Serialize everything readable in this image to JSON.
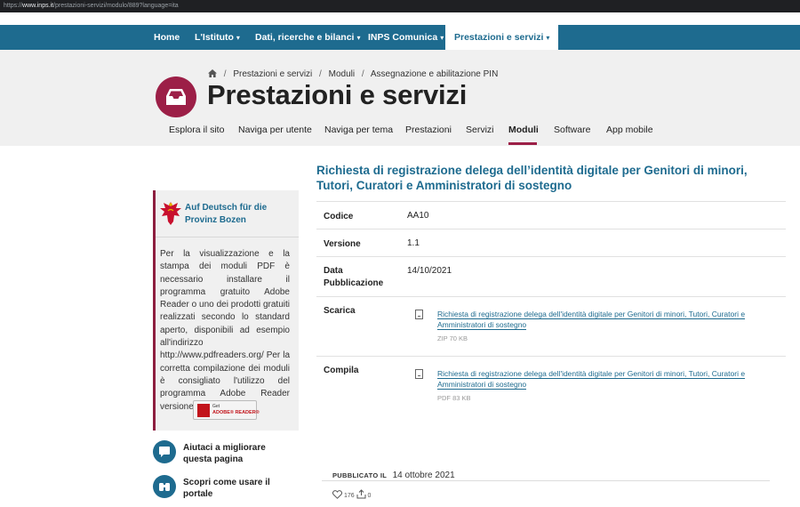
{
  "browser": {
    "url_prefix": "https://",
    "url_host": "www.inps.it",
    "url_path": "/prestazioni-servizi/modulo/889?language=ita"
  },
  "topnav": {
    "items": [
      {
        "label": "Home",
        "has_menu": false
      },
      {
        "label": "L'Istituto",
        "has_menu": true
      },
      {
        "label": "Dati, ricerche e bilanci",
        "has_menu": true
      },
      {
        "label": "INPS Comunica",
        "has_menu": true
      },
      {
        "label": "Prestazioni e servizi",
        "has_menu": true,
        "active": true
      }
    ]
  },
  "breadcrumb": {
    "items": [
      "Prestazioni e servizi",
      "Moduli",
      "Assegnazione e abilitazione PIN"
    ]
  },
  "page_title": "Prestazioni e servizi",
  "subnav": {
    "items": [
      "Esplora il sito",
      "Naviga per utente",
      "Naviga per tema",
      "Prestazioni",
      "Servizi",
      "Moduli",
      "Software",
      "App mobile"
    ],
    "active": "Moduli"
  },
  "sidebar": {
    "german_link": "Auf Deutsch für die Provinz Bozen",
    "pdf_info": "Per la visualizzazione e la stampa dei moduli PDF è necessario installare il programma gratuito Adobe Reader o uno dei prodotti gratuiti realizzati secondo lo standard aperto, disponibili ad esempio all'indirizzo http://www.pdfreaders.org/ Per la corretta compilazione dei moduli è consigliato l'utilizzo del programma Adobe Reader versione 8 o successiva.",
    "adobe_button": {
      "line1": "Get",
      "line2": "ADOBE® READER®"
    },
    "help": [
      {
        "label": "Aiutaci a migliorare questa pagina",
        "icon": "chat-icon"
      },
      {
        "label": "Scopri come usare il portale",
        "icon": "binoculars-icon"
      }
    ]
  },
  "main": {
    "title": "Richiesta di registrazione delega dell’identità digitale per Genitori di minori, Tutori, Curatori e Amministratori di sostegno",
    "fields": {
      "codice_label": "Codice",
      "codice_value": "AA10",
      "versione_label": "Versione",
      "versione_value": "1.1",
      "data_label": "Data Pubblicazione",
      "data_value": "14/10/2021",
      "scarica_label": "Scarica",
      "scarica_link": "Richiesta di registrazione delega dell'identità digitale per Genitori di minori, Tutori, Curatori e Amministratori di sostegno",
      "scarica_meta": "ZIP 70 KB",
      "compila_label": "Compila",
      "compila_link": "Richiesta di registrazione delega dell'identità digitale per Genitori di minori, Tutori, Curatori e Amministratori di sostegno",
      "compila_meta": "PDF 83 KB"
    },
    "published_label": "PUBBLICATO IL",
    "published_date": "14 ottobre 2021",
    "likes": "176",
    "shares": "0"
  },
  "colors": {
    "brand_blue": "#1e6b8f",
    "accent_burgundy": "#9c1f47"
  }
}
